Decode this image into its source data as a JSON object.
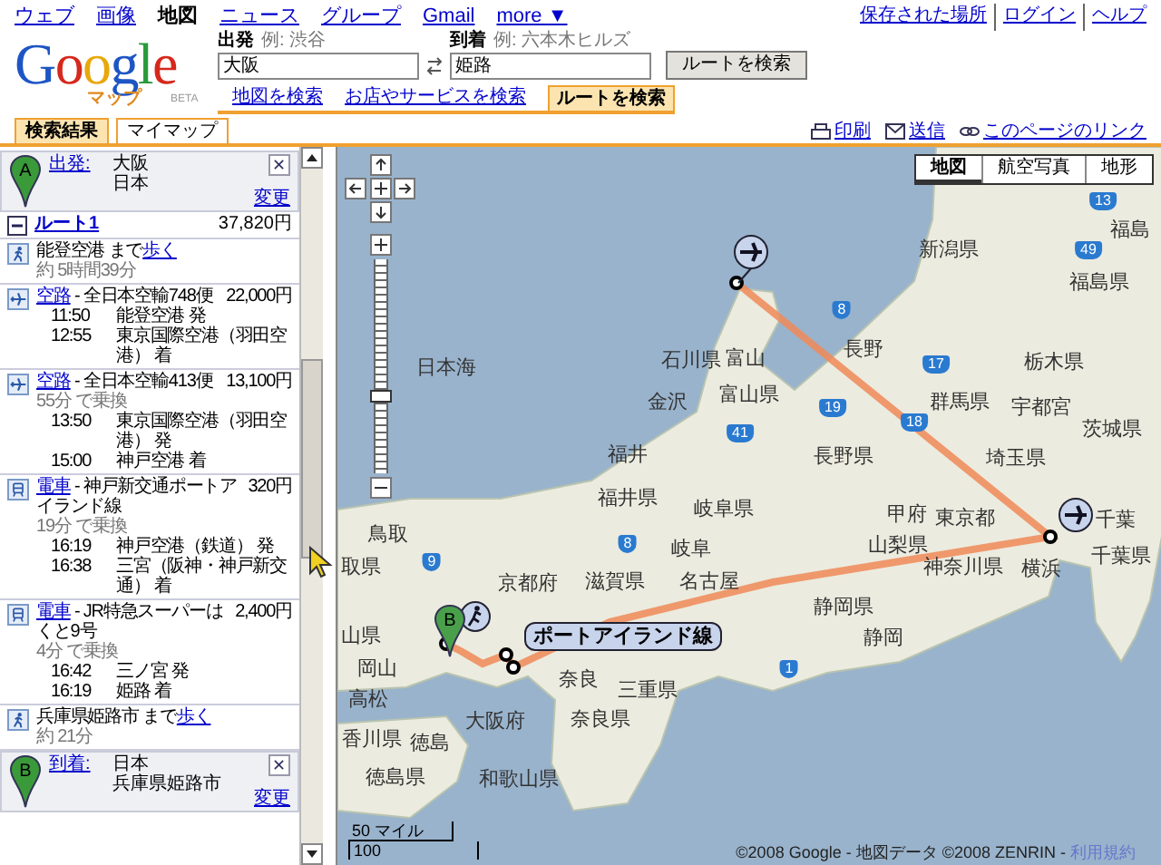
{
  "top_nav": {
    "items": [
      {
        "label": "ウェブ",
        "selected": false
      },
      {
        "label": "画像",
        "selected": false
      },
      {
        "label": "地図",
        "selected": true
      },
      {
        "label": "ニュース",
        "selected": false
      },
      {
        "label": "グループ",
        "selected": false
      },
      {
        "label": "Gmail",
        "selected": false
      },
      {
        "label": "more ▼",
        "selected": false
      }
    ],
    "right_links": [
      "保存された場所",
      "ログイン",
      "ヘルプ"
    ]
  },
  "logo": {
    "word": "Google",
    "sub": "マップ",
    "beta": "BETA"
  },
  "search": {
    "from": {
      "label": "出発",
      "hint": "例: 渋谷",
      "value": "大阪"
    },
    "to": {
      "label": "到着",
      "hint": "例: 六本木ヒルズ",
      "value": "姫路"
    },
    "button": "ルートを検索",
    "tabs": [
      {
        "label": "地図を検索",
        "selected": false
      },
      {
        "label": "お店やサービスを検索",
        "selected": false
      },
      {
        "label": "ルートを検索",
        "selected": true
      }
    ]
  },
  "panel_tabs": [
    {
      "label": "検索結果",
      "selected": true
    },
    {
      "label": "マイマップ",
      "selected": false
    }
  ],
  "page_links": [
    "印刷",
    "送信",
    "このページのリンク"
  ],
  "start": {
    "pin": "A",
    "label": "出発:",
    "lines": [
      "大阪",
      "日本"
    ],
    "close": "✕",
    "change": "変更"
  },
  "route": {
    "title": "ルート1",
    "fare": "37,820円",
    "expanded": true
  },
  "steps": [
    {
      "kind": "walk",
      "text": "能登空港 まで",
      "link": "歩く",
      "note": "約 5時間39分"
    },
    {
      "kind": "flight",
      "link": "空路",
      "text": " - 全日本空輸748便",
      "fare": "22,000円",
      "times": [
        {
          "time": "11:50",
          "place": "能登空港 発"
        },
        {
          "time": "12:55",
          "place": "東京国際空港（羽田空港） 着"
        }
      ]
    },
    {
      "kind": "flight",
      "link": "空路",
      "text": " - 全日本空輸413便",
      "fare": "13,100円",
      "note": "55分 で乗換",
      "times": [
        {
          "time": "13:50",
          "place": "東京国際空港（羽田空港） 発"
        },
        {
          "time": "15:00",
          "place": "神戸空港 着"
        }
      ]
    },
    {
      "kind": "train",
      "link": "電車",
      "text": " - 神戸新交通ポートアイランド線",
      "fare": "320円",
      "note": "19分 で乗換",
      "times": [
        {
          "time": "16:19",
          "place": "神戸空港（鉄道） 発"
        },
        {
          "time": "16:38",
          "place": "三宮（阪神・神戸新交通） 着"
        }
      ]
    },
    {
      "kind": "train",
      "link": "電車",
      "text": " - JR特急スーパーはくと9号",
      "fare": "2,400円",
      "note": "4分 で乗換",
      "times": [
        {
          "time": "16:42",
          "place": "三ノ宮 発"
        },
        {
          "time": "16:19",
          "place": "姫路 着"
        }
      ]
    },
    {
      "kind": "walk",
      "text": "兵庫県姫路市 まで",
      "link": "歩く",
      "note": "約 21分"
    }
  ],
  "end": {
    "pin": "B",
    "label": "到着:",
    "lines": [
      "日本",
      "兵庫県姫路市"
    ],
    "close": "✕",
    "change": "変更"
  },
  "map": {
    "types": [
      {
        "label": "地図",
        "selected": true
      },
      {
        "label": "航空写真",
        "selected": false
      },
      {
        "label": "地形",
        "selected": false
      }
    ],
    "zoom": {
      "level": 0.36
    },
    "labels": [
      "日本海",
      "新潟県",
      "福島",
      "福島県",
      "石川県",
      "富山",
      "金沢",
      "富山県",
      "長野",
      "群馬県",
      "栃木県",
      "宇都宮",
      "茨城県",
      "福井",
      "長野県",
      "埼玉県",
      "福井県",
      "岐阜県",
      "甲府",
      "東京都",
      "千葉",
      "山梨県",
      "千葉県",
      "鳥取",
      "取県",
      "岐阜",
      "京都府",
      "滋賀県",
      "名古屋",
      "神奈川県",
      "横浜",
      "静岡県",
      "山県",
      "静岡",
      "岡山",
      "奈良",
      "三重県",
      "高松",
      "大阪府",
      "奈良県",
      "香川県",
      "徳島",
      "徳島県",
      "和歌山県"
    ],
    "shields": [
      "13",
      "49",
      "8",
      "17",
      "19",
      "18",
      "41",
      "9",
      "8",
      "1"
    ],
    "route_label": "ポートアイランド線",
    "end_pin": "B",
    "scale": [
      "50 マイル",
      "100"
    ],
    "attribution": "©2008 Google - 地図データ ©2008 ZENRIN - ",
    "terms": "利用規約"
  }
}
